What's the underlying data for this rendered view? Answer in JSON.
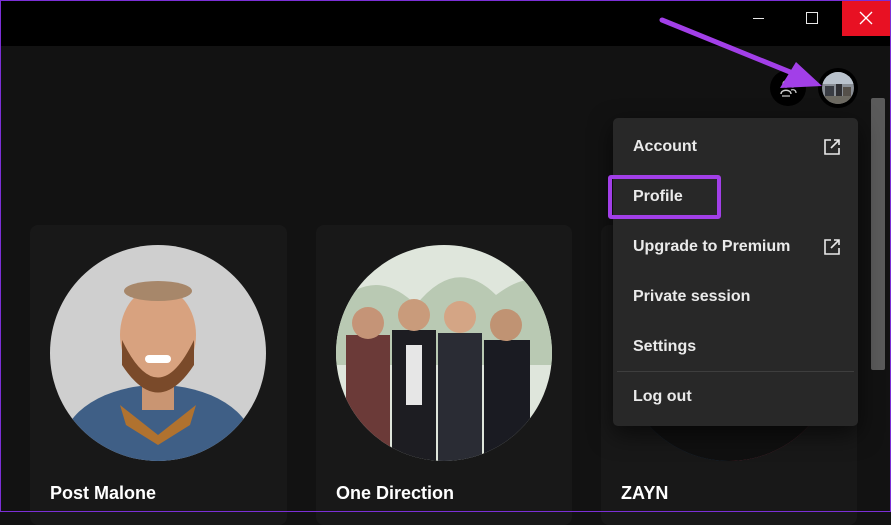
{
  "window": {
    "controls": {
      "minimize_icon": "minimize-icon",
      "maximize_icon": "maximize-icon",
      "close_icon": "close-icon",
      "close_color": "#e81123"
    }
  },
  "header": {
    "friends_icon": "friend-activity-icon",
    "avatar_icon": "user-avatar"
  },
  "menu": {
    "items": [
      {
        "label": "Account",
        "external": true
      },
      {
        "label": "Profile",
        "external": false,
        "highlighted": true
      },
      {
        "label": "Upgrade to Premium",
        "external": true
      },
      {
        "label": "Private session",
        "external": false
      },
      {
        "label": "Settings",
        "external": false
      },
      {
        "label": "Log out",
        "external": false
      }
    ],
    "highlight_color": "#a23fe8"
  },
  "cards": [
    {
      "title": "Post Malone"
    },
    {
      "title": "One Direction"
    },
    {
      "title": "ZAYN"
    }
  ],
  "annotation": {
    "arrow_color": "#a23fe8"
  }
}
